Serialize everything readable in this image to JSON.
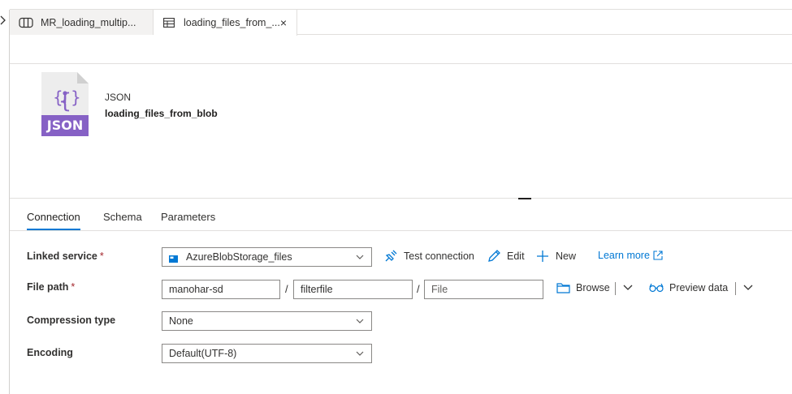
{
  "tabs": [
    {
      "label": "MR_loading_multip...",
      "icon": "pipeline-icon"
    },
    {
      "label": "loading_files_from_...",
      "icon": "table-icon",
      "close": "×"
    }
  ],
  "dataset": {
    "icon_label": "JSON",
    "type": "JSON",
    "name": "loading_files_from_blob"
  },
  "panel_tabs": [
    "Connection",
    "Schema",
    "Parameters"
  ],
  "form": {
    "linked_service": {
      "label": "Linked service",
      "required": "*",
      "value": "AzureBlobStorage_files",
      "actions": {
        "test": "Test connection",
        "edit": "Edit",
        "new": "New",
        "learn": "Learn more"
      }
    },
    "file_path": {
      "label": "File path",
      "required": "*",
      "container": "manohar-sd",
      "directory": "filterfile",
      "file_placeholder": "File",
      "sep": "/",
      "browse": "Browse",
      "preview": "Preview data"
    },
    "compression": {
      "label": "Compression type",
      "value": "None"
    },
    "encoding": {
      "label": "Encoding",
      "value": "Default(UTF-8)"
    }
  },
  "colors": {
    "accent": "#0078d4",
    "json_icon": "#8661c5",
    "required": "#a4262c"
  }
}
